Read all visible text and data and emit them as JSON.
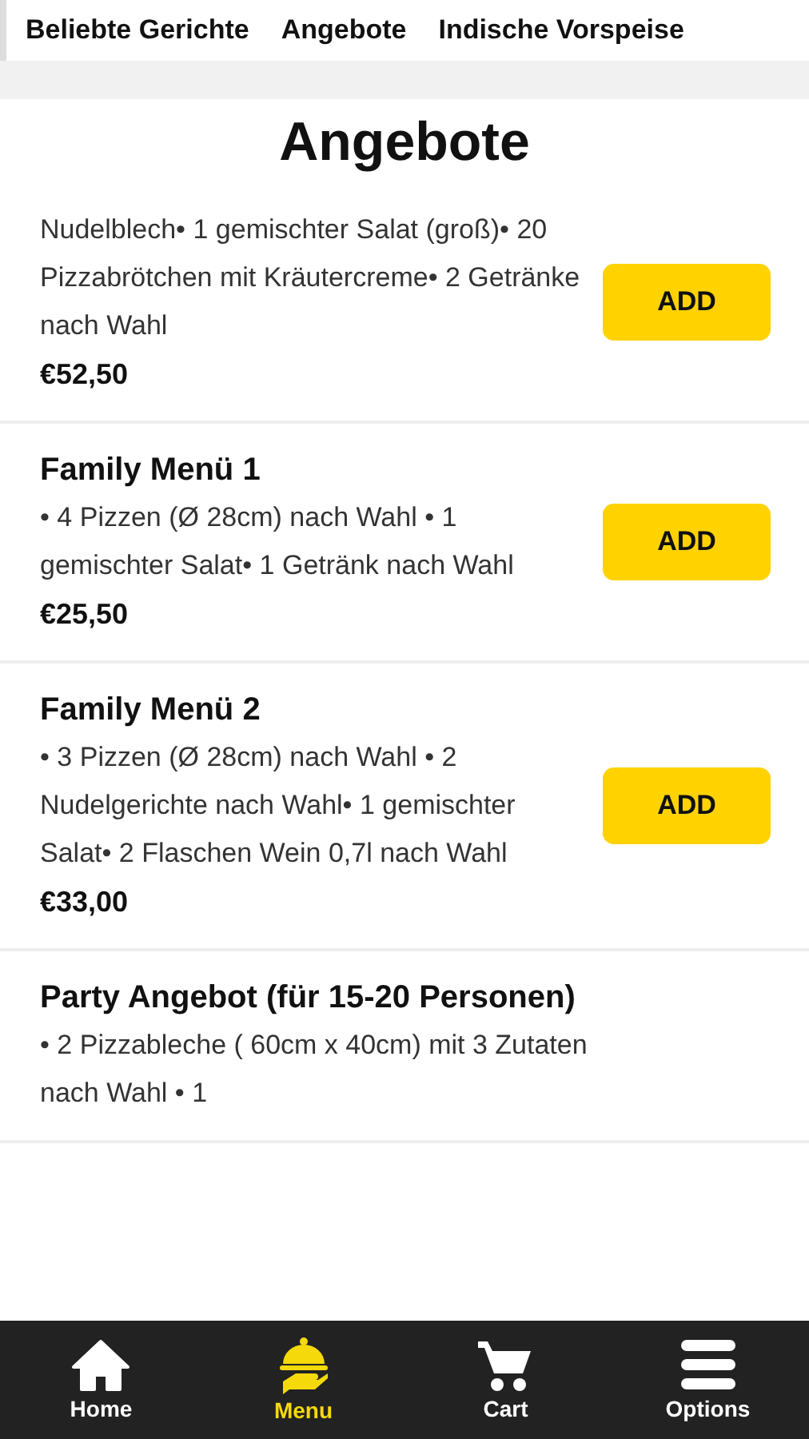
{
  "category_tabs": [
    {
      "label": "Beliebte Gerichte"
    },
    {
      "label": "Angebote"
    },
    {
      "label": "Indische Vorspeise"
    }
  ],
  "section_title": "Angebote",
  "items": [
    {
      "description": "Nudelblech• 1 gemischter Salat (groß)• 20 Pizzabrötchen mit Kräutercreme• 2 Getränke nach Wahl",
      "price": "€52,50",
      "add_label": "ADD"
    },
    {
      "title": "Family Menü 1",
      "description": "• 4 Pizzen (Ø 28cm) nach Wahl • 1 gemischter Salat• 1 Getränk nach Wahl",
      "price": "€25,50",
      "add_label": "ADD"
    },
    {
      "title": "Family Menü 2",
      "description": "• 3 Pizzen (Ø 28cm) nach Wahl • 2 Nudelgerichte nach Wahl• 1 gemischter Salat• 2 Flaschen Wein 0,7l nach Wahl",
      "price": "€33,00",
      "add_label": "ADD"
    },
    {
      "title": "Party Angebot (für 15-20 Personen)",
      "description": "• 2 Pizzableche ( 60cm x 40cm) mit 3 Zutaten nach Wahl • 1"
    }
  ],
  "bottom_nav": [
    {
      "kind": "home",
      "label": "Home",
      "selected": false
    },
    {
      "kind": "menu",
      "label": "Menu",
      "selected": true
    },
    {
      "kind": "cart",
      "label": "Cart",
      "selected": false
    },
    {
      "kind": "options",
      "label": "Options",
      "selected": false
    }
  ]
}
